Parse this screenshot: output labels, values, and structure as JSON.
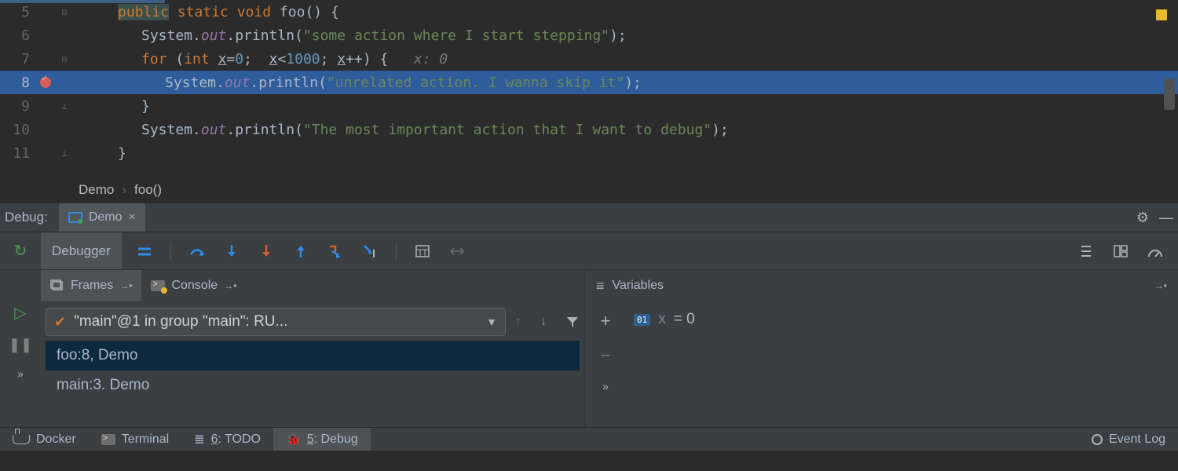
{
  "editor": {
    "lines": [
      {
        "n": "5"
      },
      {
        "n": "6",
        "str": "\"some action where I start stepping\""
      },
      {
        "n": "7",
        "hint": "x: 0"
      },
      {
        "n": "8",
        "str": "\"unrelated action. I wanna skip it\""
      },
      {
        "n": "9"
      },
      {
        "n": "10",
        "str": "\"The most important action that I want to debug\""
      },
      {
        "n": "11"
      }
    ],
    "for_limit": "1000",
    "for_init": "0"
  },
  "breadcrumbs": {
    "class": "Demo",
    "method": "foo()"
  },
  "debug_header": {
    "label": "Debug:",
    "run_config": "Demo"
  },
  "debugger_tab": "Debugger",
  "frames": {
    "title": "Frames",
    "console": "Console",
    "thread": "\"main\"@1 in group \"main\": RU...",
    "items": [
      "foo:8, Demo",
      "main:3. Demo"
    ]
  },
  "variables": {
    "title": "Variables",
    "items": [
      {
        "badge": "01",
        "name": "x",
        "value": "= 0"
      }
    ]
  },
  "bottom": {
    "docker": "Docker",
    "terminal": "Terminal",
    "todo_pre": "6",
    "todo_post": ": TODO",
    "debug_pre": "5",
    "debug_post": ": Debug",
    "event_log": "Event Log"
  }
}
